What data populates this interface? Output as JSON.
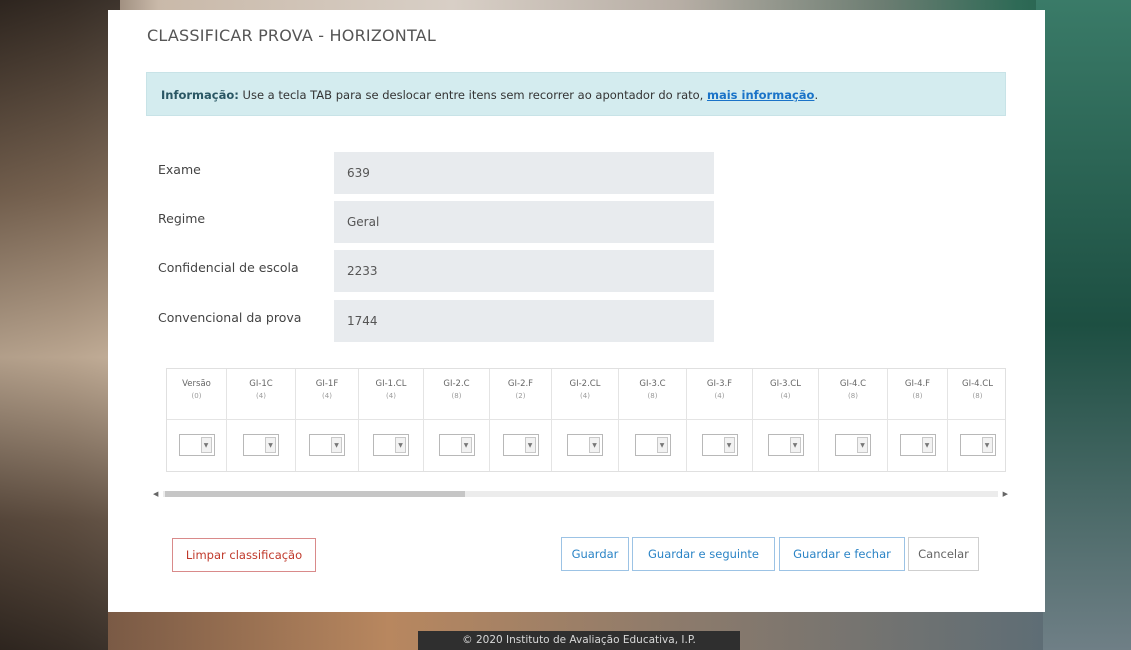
{
  "footer": "© 2020 Instituto de Avaliação Educativa, I.P.",
  "modal": {
    "title": "CLASSIFICAR PROVA - HORIZONTAL",
    "info": {
      "label": "Informação:",
      "text": "Use a tecla TAB para se deslocar entre itens sem recorrer ao apontador do rato,",
      "link": "mais informação",
      "tail": "."
    },
    "fields": [
      {
        "label": "Exame",
        "value": "639"
      },
      {
        "label": "Regime",
        "value": "Geral"
      },
      {
        "label": "Confidencial de escola",
        "value": "2233"
      },
      {
        "label": "Convencional da prova",
        "value": "1744"
      }
    ],
    "grid": {
      "columns": [
        {
          "name": "Versão",
          "sub": "(0)"
        },
        {
          "name": "GI-1C",
          "sub": "(4)"
        },
        {
          "name": "GI-1F",
          "sub": "(4)"
        },
        {
          "name": "GI-1.CL",
          "sub": "(4)"
        },
        {
          "name": "GI-2.C",
          "sub": "(8)"
        },
        {
          "name": "GI-2.F",
          "sub": "(2)"
        },
        {
          "name": "GI-2.CL",
          "sub": "(4)"
        },
        {
          "name": "GI-3.C",
          "sub": "(8)"
        },
        {
          "name": "GI-3.F",
          "sub": "(4)"
        },
        {
          "name": "GI-3.CL",
          "sub": "(4)"
        },
        {
          "name": "GI-4.C",
          "sub": "(8)"
        },
        {
          "name": "GI-4.F",
          "sub": "(8)"
        },
        {
          "name": "GI-4.CL",
          "sub": "(8)"
        }
      ]
    },
    "buttons": {
      "clear": "Limpar classificação",
      "save": "Guardar",
      "save_next": "Guardar e seguinte",
      "save_close": "Guardar e fechar",
      "cancel": "Cancelar"
    }
  }
}
